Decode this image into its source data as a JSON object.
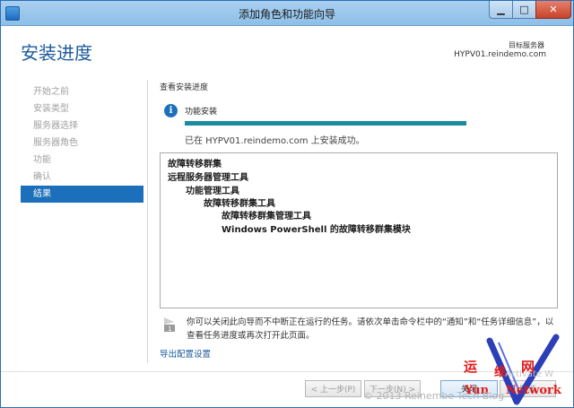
{
  "window": {
    "title": "添加角色和功能向导",
    "minimize": "▁",
    "maximize": "□",
    "close": "✕"
  },
  "header": {
    "page_title": "安装进度",
    "target_label": "目标服务器",
    "target_server": "HYPV01.reindemo.com"
  },
  "nav": {
    "items": [
      {
        "label": "开始之前",
        "active": false
      },
      {
        "label": "安装类型",
        "active": false
      },
      {
        "label": "服务器选择",
        "active": false
      },
      {
        "label": "服务器角色",
        "active": false
      },
      {
        "label": "功能",
        "active": false
      },
      {
        "label": "确认",
        "active": false
      },
      {
        "label": "结果",
        "active": true
      }
    ]
  },
  "main": {
    "section_title": "查看安装进度",
    "info_icon": "i",
    "feature_label": "功能安装",
    "progress": 1.0,
    "status": "已在 HYPV01.reindemo.com 上安装成功。",
    "results": [
      {
        "text": "故障转移群集",
        "level": 0
      },
      {
        "text": "远程服务器管理工具",
        "level": 0
      },
      {
        "text": "功能管理工具",
        "level": 1
      },
      {
        "text": "故障转移群集工具",
        "level": 2
      },
      {
        "text": "故障转移群集管理工具",
        "level": 3
      },
      {
        "text": "Windows PowerShell 的故障转移群集模块",
        "level": 3
      }
    ],
    "note": "你可以关闭此向导而不中断正在运行的任务。请依次单击命令栏中的“通知”和“任务详细信息”，以查看任务进度或再次打开此页面。",
    "export_link": "导出配置设置"
  },
  "footer": {
    "prev": "< 上一步(P)",
    "next": "下一步(N) >",
    "close": "关闭",
    "cancel": "取消"
  },
  "watermark": {
    "activate": "Activate W",
    "yun": "运",
    "wei": "维",
    "wang": "网",
    "yun_en": "Yun",
    "network": "Network",
    "copyright": "© 2013 Reinembe  Tech Blog"
  },
  "colors": {
    "accent": "#1c6fbb",
    "progress": "#1a8ca0",
    "watermark": "#e01a1a"
  }
}
